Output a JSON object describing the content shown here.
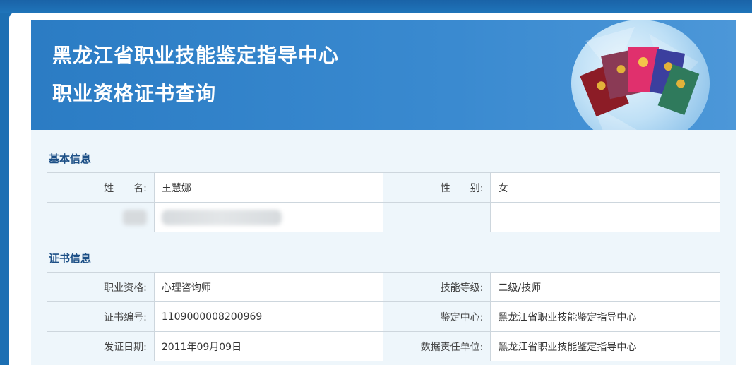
{
  "banner": {
    "title": "黑龙江省职业技能鉴定指导中心",
    "subtitle": "职业资格证书查询"
  },
  "basic_info": {
    "section_title": "基本信息",
    "name_label": "姓　　名:",
    "name_value": "王慧娜",
    "gender_label": "性　　别:",
    "gender_value": "女"
  },
  "cert_info": {
    "section_title": "证书信息",
    "occupation_label": "职业资格:",
    "occupation_value": "心理咨询师",
    "level_label": "技能等级:",
    "level_value": "二级/技师",
    "cert_no_label": "证书编号:",
    "cert_no_value": "1109000008200969",
    "center_label": "鉴定中心:",
    "center_value": "黑龙江省职业技能鉴定指导中心",
    "issue_date_label": "发证日期:",
    "issue_date_value": "2011年09月09日",
    "unit_label": "数据责任单位:",
    "unit_value": "黑龙江省职业技能鉴定指导中心"
  },
  "colors": {
    "banner": "#2b7cc4",
    "section_title": "#1c4f86",
    "label_bg": "#eef6fb",
    "border": "#cdd6dd"
  }
}
